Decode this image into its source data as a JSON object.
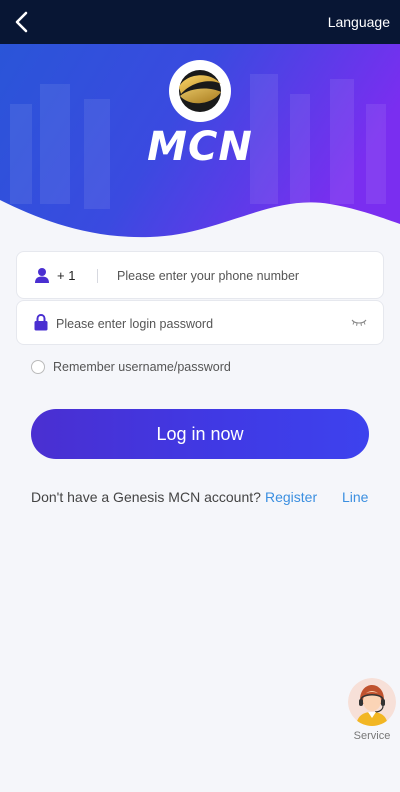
{
  "topbar": {
    "back_icon": "chevron-left-icon",
    "language_label": "Language"
  },
  "hero": {
    "logo_icon": "mcn-globe-logo",
    "brand_name": "MCN"
  },
  "form": {
    "phone": {
      "icon": "user-icon",
      "country_code": "+ 1",
      "placeholder": "Please enter your phone number",
      "value": ""
    },
    "password": {
      "icon": "lock-icon",
      "placeholder": "Please enter login password",
      "value": "",
      "toggle_icon": "eye-closed-icon"
    },
    "remember_label": "Remember username/password",
    "remember_checked": false,
    "login_label": "Log in now"
  },
  "signup": {
    "prompt": "Don't have a Genesis MCN account?",
    "register_label": "Register",
    "line_label": "Line"
  },
  "service": {
    "icon": "customer-service-avatar",
    "label": "Service"
  },
  "colors": {
    "topbar_bg": "#081634",
    "accent": "#4039e4",
    "link": "#3b8fe0",
    "field_icon": "#4a2fd1"
  }
}
